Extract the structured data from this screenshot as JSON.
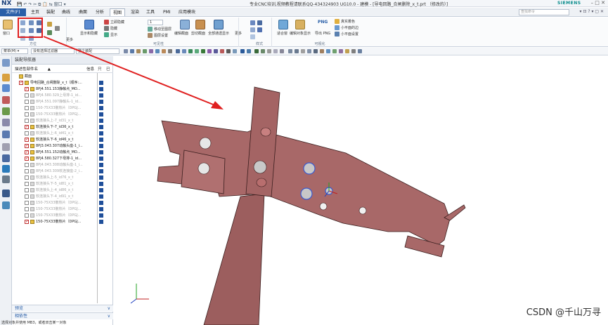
{
  "titlebar": {
    "logo": "NX",
    "quick_access": "💾 ↶ ↷ ✂ ⧉ 📋 ⇆ 窗口 ▾",
    "title": "专业CNC培训,视频教程请联系QQ-434324903 UG10.0 - 建模 - [导电回路_合闸删除_x_t.prt （修改的）]",
    "brand": "SIEMENS",
    "window_controls": "– □ ✕"
  },
  "menubar": {
    "file": "文件(F)",
    "items": [
      "主页",
      "装配",
      "曲线",
      "曲面",
      "分析",
      "视图",
      "渲染",
      "工具",
      "PMI",
      "应用模块"
    ],
    "active": "视图",
    "search_placeholder": "查找命令",
    "right": "▾ ⊡ ? ▾ ▢ ✕"
  },
  "ribbon": {
    "groups": [
      {
        "label": "方位"
      },
      {
        "label": "可见性"
      },
      {
        "label": "样式"
      },
      {
        "label": "可视化"
      }
    ],
    "buttons": {
      "orient_menu": "窗口",
      "more1": "更多",
      "show_hide": "显示和隐藏",
      "immediate_hide": "立即隐藏",
      "hide": "隐藏",
      "show": "显示",
      "layer_num": "1",
      "move_to_layer": "移动至图层",
      "layer_settings": "图层设置",
      "edit_section": "编辑截面",
      "clip_section": "剪切截面",
      "all_wcs": "全部通透显示",
      "more2": "更多",
      "fit": "适合窗",
      "edit_object_display": "编辑对象显示",
      "png": "PNG",
      "png_label": "导出 PNG",
      "true_shading": "真实着色",
      "lights_scene": "小平面的边",
      "scene_settings": "小平面设置",
      "more3": "更多"
    }
  },
  "toolbar2": {
    "menu": "菜单(M) ▾",
    "filter": "没有选择过滤器",
    "assembly": "整个装配"
  },
  "navigator": {
    "title": "装配导航器",
    "col_name": "描述性部件名",
    "col_sort": "▲",
    "col_info": "信息",
    "col_r": "只",
    "col_m": "已",
    "rows": [
      {
        "label": "截面",
        "checked": false,
        "dim": false,
        "indent": 0
      },
      {
        "label": "导电回路_合闸删除_x_t（顺序:...",
        "checked": true,
        "dim": false,
        "indent": 0
      },
      {
        "label": "8PJ4.551.153静触点_MO...",
        "checked": true,
        "dim": false,
        "indent": 1
      },
      {
        "label": "8PJ4.580.329上母排-1_id...",
        "checked": false,
        "dim": true,
        "indent": 1
      },
      {
        "label": "8PJ4.551.097静触头-1_id...",
        "checked": false,
        "dim": true,
        "indent": 1
      },
      {
        "label": "150-75X33散热片（DPGJ...",
        "checked": false,
        "dim": true,
        "indent": 1
      },
      {
        "label": "150-75X33散热片（DPGJ...",
        "checked": false,
        "dim": true,
        "indent": 1
      },
      {
        "label": "软连接头上-7_id31_x_t",
        "checked": false,
        "dim": true,
        "indent": 1
      },
      {
        "label": "软连接头下-7_id36_x_t",
        "checked": true,
        "dim": false,
        "indent": 1
      },
      {
        "label": "软连接头上-6_id41_x_t",
        "checked": false,
        "dim": true,
        "indent": 1
      },
      {
        "label": "软连接头下-6_id46_x_t",
        "checked": true,
        "dim": false,
        "indent": 1
      },
      {
        "label": "8PJ3.043.307动触头座-1_i...",
        "checked": true,
        "dim": false,
        "indent": 1
      },
      {
        "label": "8PJ4.551.152动触点_MO...",
        "checked": true,
        "dim": false,
        "indent": 1
      },
      {
        "label": "8PJ4.580.327下母排-1_id...",
        "checked": true,
        "dim": false,
        "indent": 1
      },
      {
        "label": "8PJ4.043.308动触头座-1_i...",
        "checked": false,
        "dim": true,
        "indent": 1
      },
      {
        "label": "8PJ4.043.309软连接座-2_i...",
        "checked": false,
        "dim": true,
        "indent": 1
      },
      {
        "label": "软连接头上-5_id76_x_t",
        "checked": false,
        "dim": true,
        "indent": 1
      },
      {
        "label": "软连接头下-5_id81_x_t",
        "checked": false,
        "dim": true,
        "indent": 1
      },
      {
        "label": "软连接头上-4_id86_x_t",
        "checked": false,
        "dim": true,
        "indent": 1
      },
      {
        "label": "软连接头下-4_id91_x_t",
        "checked": false,
        "dim": true,
        "indent": 1
      },
      {
        "label": "150-75X33散热片（DPGJ...",
        "checked": false,
        "dim": true,
        "indent": 1
      },
      {
        "label": "150-75X33散热片（DPGJ...",
        "checked": false,
        "dim": true,
        "indent": 1
      },
      {
        "label": "150-75X33散热片（DPGJ...",
        "checked": false,
        "dim": true,
        "indent": 1
      },
      {
        "label": "150-75X33散热片（DPGJ...",
        "checked": true,
        "dim": false,
        "indent": 1
      }
    ],
    "preview": "预览",
    "dependency": "相依性"
  },
  "viewport": {
    "watermark": "CSDN @千山万寻"
  },
  "statusbar": {
    "text": "选择对象并使用 MB3，或者双击某一对象"
  },
  "colors": {
    "part": "#a86868",
    "part_edge": "#3a1e1e",
    "accent": "#2a5fa8",
    "highlight": "#e02020"
  }
}
